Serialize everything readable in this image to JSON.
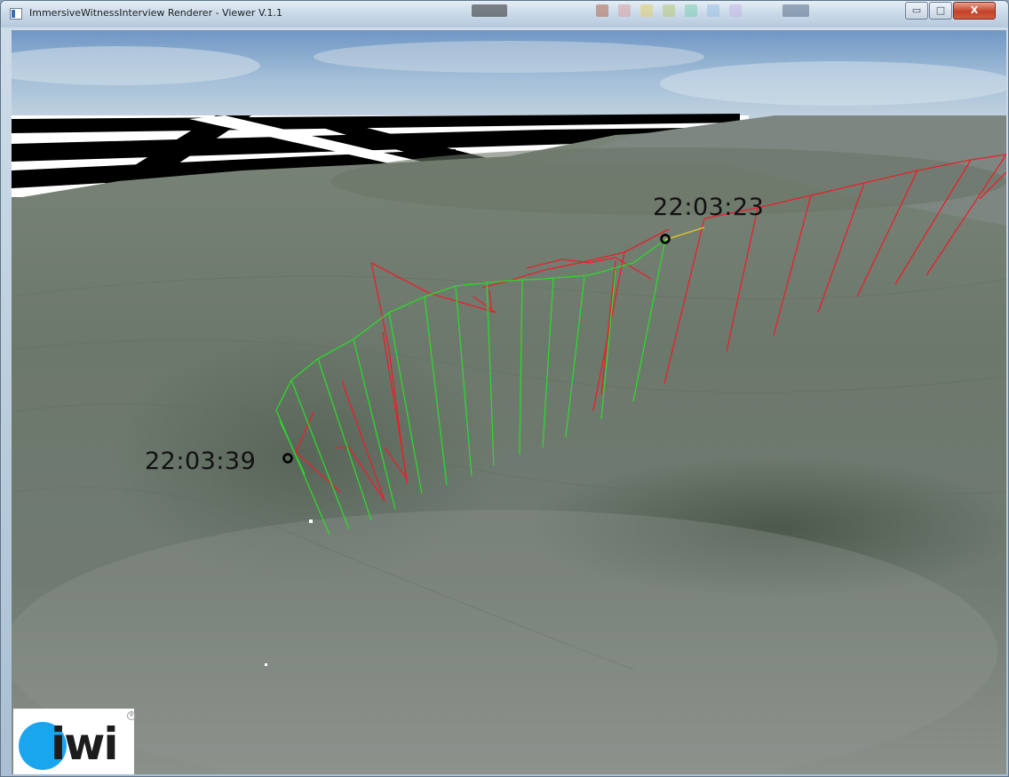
{
  "window": {
    "title": "ImmersiveWitnessInterview Renderer - Viewer V.1.1",
    "controls": {
      "minimize": "▭",
      "maximize": "□",
      "close": "X"
    }
  },
  "viewport": {
    "timestamps": [
      {
        "label": "22:03:23",
        "marker": "start"
      },
      {
        "label": "22:03:39",
        "marker": "end"
      }
    ],
    "colors": {
      "sky": "#8fb3d6",
      "terrain": "#6e7b70",
      "path_red": "#e8202a",
      "path_green": "#2bd92b",
      "marker": "#000000"
    }
  },
  "logo": {
    "text": "iwi",
    "registered": "®",
    "circle_color": "#1aa6ef"
  }
}
